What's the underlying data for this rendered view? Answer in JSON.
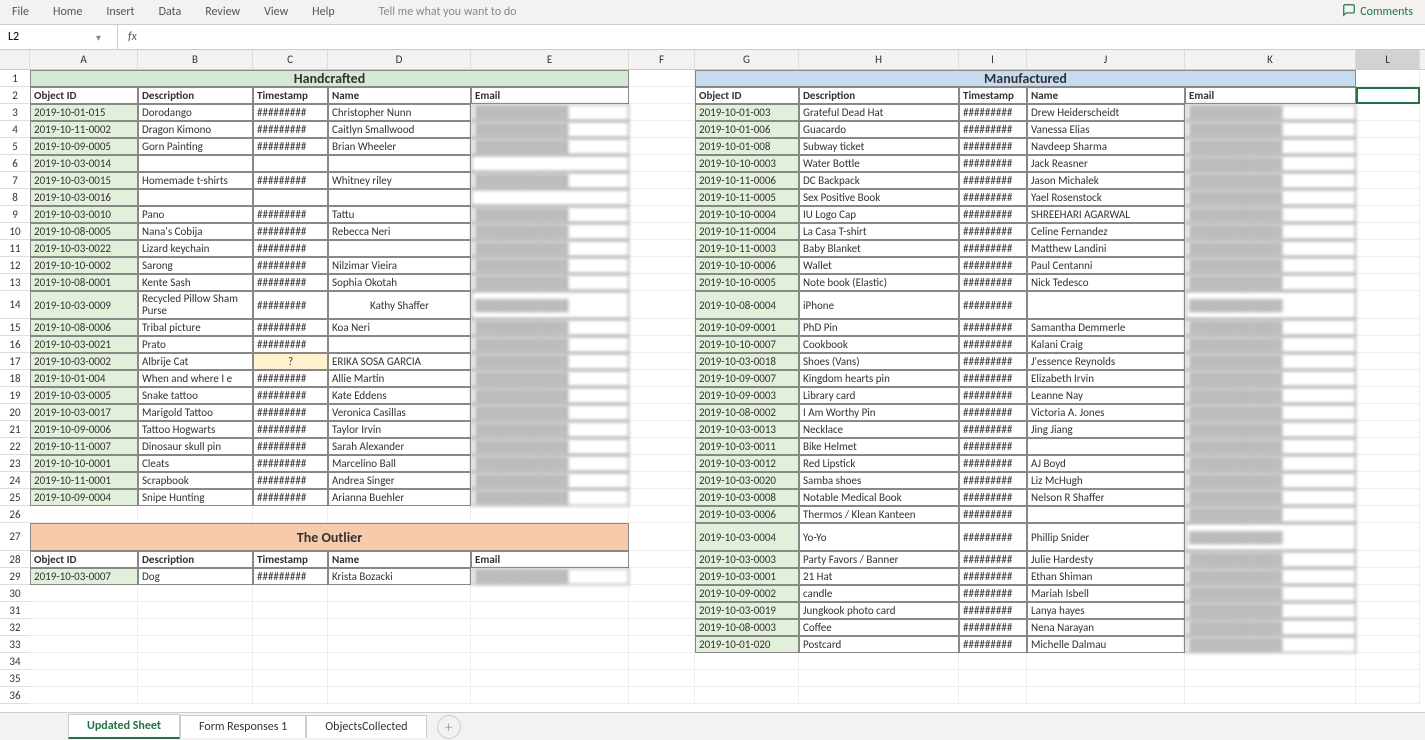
{
  "ribbon": {
    "tabs": [
      "File",
      "Home",
      "Insert",
      "Data",
      "Review",
      "View",
      "Help"
    ],
    "search_placeholder": "Tell me what you want to do",
    "comments": "Comments"
  },
  "formula_bar": {
    "name_box": "L2",
    "fx": "fx",
    "formula": ""
  },
  "columns": [
    {
      "l": "",
      "w": 30
    },
    {
      "l": "A",
      "w": 108
    },
    {
      "l": "B",
      "w": 115
    },
    {
      "l": "C",
      "w": 75
    },
    {
      "l": "D",
      "w": 143
    },
    {
      "l": "E",
      "w": 158
    },
    {
      "l": "F",
      "w": 66
    },
    {
      "l": "G",
      "w": 104
    },
    {
      "l": "H",
      "w": 160
    },
    {
      "l": "I",
      "w": 68
    },
    {
      "l": "J",
      "w": 158
    },
    {
      "l": "K",
      "w": 171
    },
    {
      "l": "L",
      "w": 64
    }
  ],
  "sections": {
    "handcrafted": {
      "title": "Handcrafted",
      "headers": [
        "Object ID",
        "Description",
        "Timestamp",
        "Name",
        "Email"
      ]
    },
    "manufactured": {
      "title": "Manufactured",
      "headers": [
        "Object ID",
        "Description",
        "Timestamp",
        "Name",
        "Email"
      ]
    },
    "outlier": {
      "title": "The Outlier",
      "headers": [
        "Object ID",
        "Description",
        "Timestamp",
        "Name",
        "Email"
      ]
    }
  },
  "hash": "#########",
  "q": "?",
  "chart_data": {
    "type": "table",
    "handcrafted": [
      {
        "id": "2019-10-01-015",
        "desc": "Dorodango",
        "ts": "#########",
        "name": "Christopher Nunn",
        "email": "redacted"
      },
      {
        "id": "2019-10-11-0002",
        "desc": "Dragon Kimono",
        "ts": "#########",
        "name": "Caitlyn Smallwood",
        "email": "redacted"
      },
      {
        "id": "2019-10-09-0005",
        "desc": "Gorn Painting",
        "ts": "#########",
        "name": "Brian Wheeler",
        "email": "redacted"
      },
      {
        "id": "2019-10-03-0014",
        "desc": "",
        "ts": "",
        "name": "",
        "email": ""
      },
      {
        "id": "2019-10-03-0015",
        "desc": "Homemade t-shirts",
        "ts": "#########",
        "name": "Whitney riley",
        "email": "redacted"
      },
      {
        "id": "2019-10-03-0016",
        "desc": "",
        "ts": "",
        "name": "",
        "email": ""
      },
      {
        "id": "2019-10-03-0010",
        "desc": "Pano",
        "ts": "#########",
        "name": "Tattu",
        "email": "redacted"
      },
      {
        "id": "2019-10-08-0005",
        "desc": "Nana's Cobija",
        "ts": "#########",
        "name": "Rebecca Neri",
        "email": "redacted"
      },
      {
        "id": "2019-10-03-0022",
        "desc": "Lizard keychain",
        "ts": "#########",
        "name": "",
        "email": "redacted"
      },
      {
        "id": "2019-10-10-0002",
        "desc": "Sarong",
        "ts": "#########",
        "name": "Nilzimar Vieira",
        "email": "redacted"
      },
      {
        "id": "2019-10-08-0001",
        "desc": "Kente Sash",
        "ts": "#########",
        "name": "Sophia Okotah",
        "email": "redacted"
      },
      {
        "id": "2019-10-03-0009",
        "desc": "Recycled Pillow Sham Purse",
        "ts": "#########",
        "name": "Kathy Shaffer",
        "email": "redacted",
        "tall": true
      },
      {
        "id": "2019-10-08-0006",
        "desc": "Tribal picture",
        "ts": "#########",
        "name": "Koa Neri",
        "email": "redacted"
      },
      {
        "id": "2019-10-03-0021",
        "desc": "Prato",
        "ts": "#########",
        "name": "",
        "email": "redacted"
      },
      {
        "id": "2019-10-03-0002",
        "desc": "Albrije Cat",
        "ts": "?",
        "name": "ERIKA SOSA GARCIA",
        "email": "redacted",
        "tsq": true
      },
      {
        "id": "2019-10-01-004",
        "desc": "When and where I e",
        "ts": "#########",
        "name": "Allie Martin",
        "email": "redacted"
      },
      {
        "id": "2019-10-03-0005",
        "desc": "Snake tattoo",
        "ts": "#########",
        "name": "Kate Eddens",
        "email": "redacted"
      },
      {
        "id": "2019-10-03-0017",
        "desc": "Marigold Tattoo",
        "ts": "#########",
        "name": "Veronica Casillas",
        "email": "redacted"
      },
      {
        "id": "2019-10-09-0006",
        "desc": "Tattoo Hogwarts",
        "ts": "#########",
        "name": "Taylor Irvin",
        "email": "redacted"
      },
      {
        "id": "2019-10-11-0007",
        "desc": "Dinosaur skull pin",
        "ts": "#########",
        "name": "Sarah Alexander",
        "email": "redacted"
      },
      {
        "id": "2019-10-10-0001",
        "desc": "Cleats",
        "ts": "#########",
        "name": "Marcelino Ball",
        "email": "redacted"
      },
      {
        "id": "2019-10-11-0001",
        "desc": "Scrapbook",
        "ts": "#########",
        "name": "Andrea Singer",
        "email": "redacted"
      },
      {
        "id": "2019-10-09-0004",
        "desc": "Snipe Hunting",
        "ts": "#########",
        "name": "Arianna Buehler",
        "email": "redacted"
      }
    ],
    "manufactured": [
      {
        "id": "2019-10-01-003",
        "desc": "Grateful Dead Hat",
        "ts": "#########",
        "name": "Drew Heiderscheidt",
        "email": "redacted"
      },
      {
        "id": "2019-10-01-006",
        "desc": "Guacardo",
        "ts": "#########",
        "name": "Vanessa Elias",
        "email": "redacted"
      },
      {
        "id": "2019-10-01-008",
        "desc": "Subway ticket",
        "ts": "#########",
        "name": "Navdeep Sharma",
        "email": "redacted"
      },
      {
        "id": "2019-10-10-0003",
        "desc": "Water Bottle",
        "ts": "#########",
        "name": "Jack Reasner",
        "email": "redacted"
      },
      {
        "id": "2019-10-11-0006",
        "desc": "DC Backpack",
        "ts": "#########",
        "name": "Jason Michalek",
        "email": "redacted"
      },
      {
        "id": "2019-10-11-0005",
        "desc": "Sex Positive Book",
        "ts": "#########",
        "name": "Yael Rosenstock",
        "email": "redacted"
      },
      {
        "id": "2019-10-10-0004",
        "desc": "IU Logo Cap",
        "ts": "#########",
        "name": "SHREEHARI AGARWAL",
        "email": "redacted"
      },
      {
        "id": "2019-10-11-0004",
        "desc": "La Casa T-shirt",
        "ts": "#########",
        "name": "Celine Fernandez",
        "email": "redacted"
      },
      {
        "id": "2019-10-11-0003",
        "desc": "Baby Blanket",
        "ts": "#########",
        "name": "Matthew Landini",
        "email": "redacted"
      },
      {
        "id": "2019-10-10-0006",
        "desc": "Wallet",
        "ts": "#########",
        "name": "Paul Centanni",
        "email": "redacted"
      },
      {
        "id": "2019-10-10-0005",
        "desc": "Note book (Elastic)",
        "ts": "#########",
        "name": "Nick Tedesco",
        "email": "redacted"
      },
      {
        "id": "2019-10-08-0004",
        "desc": "iPhone",
        "ts": "#########",
        "name": "",
        "email": "redacted",
        "tall": true
      },
      {
        "id": "2019-10-09-0001",
        "desc": "PhD Pin",
        "ts": "#########",
        "name": "Samantha Demmerle",
        "email": "redacted"
      },
      {
        "id": "2019-10-10-0007",
        "desc": "Cookbook",
        "ts": "#########",
        "name": "Kalani Craig",
        "email": "redacted"
      },
      {
        "id": "2019-10-03-0018",
        "desc": "Shoes (Vans)",
        "ts": "#########",
        "name": "J'essence Reynolds",
        "email": "redacted"
      },
      {
        "id": "2019-10-09-0007",
        "desc": "Kingdom hearts pin",
        "ts": "#########",
        "name": "Elizabeth Irvin",
        "email": "redacted"
      },
      {
        "id": "2019-10-09-0003",
        "desc": "Library card",
        "ts": "#########",
        "name": "Leanne Nay",
        "email": "redacted"
      },
      {
        "id": "2019-10-08-0002",
        "desc": "I Am Worthy Pin",
        "ts": "#########",
        "name": "Victoria A. Jones",
        "email": "redacted"
      },
      {
        "id": "2019-10-03-0013",
        "desc": "Necklace",
        "ts": "#########",
        "name": "Jing Jiang",
        "email": "redacted"
      },
      {
        "id": "2019-10-03-0011",
        "desc": "Bike Helmet",
        "ts": "#########",
        "name": "",
        "email": "redacted"
      },
      {
        "id": "2019-10-03-0012",
        "desc": "Red Lipstick",
        "ts": "#########",
        "name": "AJ Boyd",
        "email": "redacted"
      },
      {
        "id": "2019-10-03-0020",
        "desc": "Samba shoes",
        "ts": "#########",
        "name": "Liz McHugh",
        "email": "redacted"
      },
      {
        "id": "2019-10-03-0008",
        "desc": "Notable Medical Book",
        "ts": "#########",
        "name": "Nelson R Shaffer",
        "email": "redacted"
      },
      {
        "id": "2019-10-03-0006",
        "desc": "Thermos / Klean Kanteen",
        "ts": "#########",
        "name": "",
        "email": "redacted"
      },
      {
        "id": "2019-10-03-0004",
        "desc": "Yo-Yo",
        "ts": "#########",
        "name": "Phillip Snider",
        "email": "redacted"
      },
      {
        "id": "2019-10-03-0003",
        "desc": "Party Favors / Banner",
        "ts": "#########",
        "name": "Julie Hardesty",
        "email": "redacted"
      },
      {
        "id": "2019-10-03-0001",
        "desc": "21 Hat",
        "ts": "#########",
        "name": "Ethan Shiman",
        "email": "redacted"
      },
      {
        "id": "2019-10-09-0002",
        "desc": "candle",
        "ts": "#########",
        "name": "Mariah Isbell",
        "email": "redacted"
      },
      {
        "id": "2019-10-03-0019",
        "desc": "Jungkook photo card",
        "ts": "#########",
        "name": "Lanya hayes",
        "email": "redacted"
      },
      {
        "id": "2019-10-08-0003",
        "desc": "Coffee",
        "ts": "#########",
        "name": "Nena Narayan",
        "email": "redacted"
      },
      {
        "id": "2019-10-01-020",
        "desc": "Postcard",
        "ts": "#########",
        "name": "Michelle Dalmau",
        "email": "redacted"
      }
    ],
    "outlier": [
      {
        "id": "2019-10-03-0007",
        "desc": "Dog",
        "ts": "#########",
        "name": "Krista Bozacki",
        "email": "redacted"
      }
    ]
  },
  "sheet_tabs": {
    "active": "Updated Sheet",
    "others": [
      "Form Responses 1",
      "ObjectsCollected"
    ]
  },
  "row_count": 36
}
